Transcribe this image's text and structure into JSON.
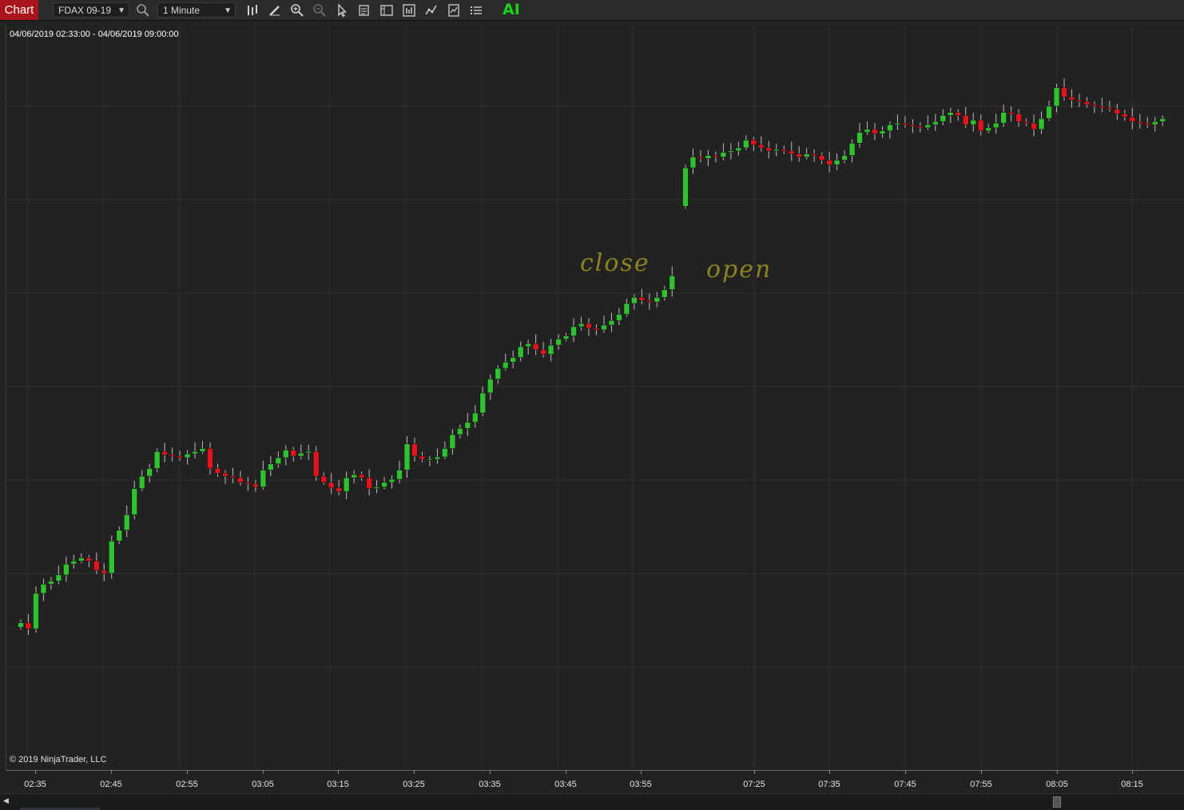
{
  "toolbar": {
    "tab_label": "Chart",
    "instrument": "FDAX 09-19",
    "interval": "1 Minute",
    "ai_label": "AI",
    "icons": [
      "search-icon",
      "bar-type-icon",
      "drawing-pencil-icon",
      "zoom-in-icon",
      "zoom-out-icon",
      "pointer-icon",
      "data-box-icon",
      "chart-trader-icon",
      "indicators-icon",
      "strategies-icon",
      "templates-icon",
      "properties-icon"
    ]
  },
  "chart": {
    "date_range": "04/06/2019 02:33:00 - 04/06/2019 09:00:00",
    "copyright": "© 2019 NinjaTrader, LLC",
    "annotations": [
      "close",
      "open"
    ],
    "up_color": "#2fc12f",
    "down_color": "#e3141b",
    "background": "#222222"
  },
  "chart_data": {
    "type": "candlestick",
    "title": "",
    "xlabel": "",
    "ylabel": "",
    "x_tick_labels": [
      "02:35",
      "02:45",
      "02:55",
      "03:05",
      "03:15",
      "03:25",
      "03:35",
      "03:45",
      "03:55",
      "07:25",
      "07:35",
      "07:45",
      "07:55",
      "08:05",
      "08:15"
    ],
    "sessions": [
      {
        "name": "close",
        "closes": [
          130,
          122,
          168,
          180,
          184,
          192,
          206,
          210,
          214,
          210,
          198,
          194,
          236,
          250,
          270,
          304,
          320,
          330,
          352,
          348,
          346,
          344,
          349,
          352,
          356,
          330,
          324,
          320,
          318,
          312,
          310,
          306,
          328,
          336,
          344,
          354,
          346,
          350,
          352,
          320,
          312,
          305,
          300,
          318,
          322,
          318,
          304,
          306,
          312,
          316,
          328,
          362,
          346,
          342,
          342,
          345,
          356,
          374,
          382,
          390,
          402,
          428,
          446,
          460,
          468,
          474,
          488,
          492,
          484,
          478,
          490,
          498,
          502,
          514,
          518,
          512,
          510,
          516,
          522,
          530,
          544,
          552,
          548,
          546,
          552,
          562,
          580
        ]
      },
      {
        "name": "open",
        "closes": [
          720,
          734,
          732,
          736,
          734,
          740,
          742,
          746,
          756,
          750,
          746,
          742,
          744,
          742,
          738,
          734,
          738,
          736,
          730,
          724,
          730,
          736,
          752,
          766,
          770,
          764,
          768,
          776,
          778,
          776,
          774,
          772,
          776,
          780,
          788,
          792,
          788,
          776,
          782,
          768,
          772,
          778,
          792,
          790,
          780,
          778,
          770,
          784,
          800,
          824,
          812,
          808,
          806,
          802,
          800,
          798,
          796,
          790,
          786,
          780,
          778,
          776,
          780,
          784
        ]
      }
    ]
  }
}
